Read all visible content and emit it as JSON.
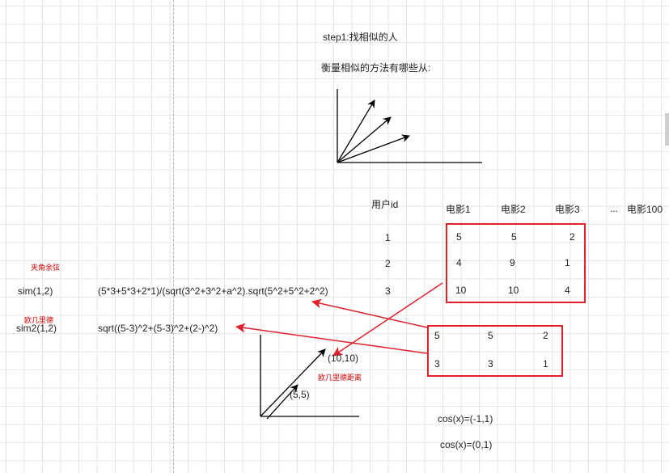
{
  "header": {
    "step": "step1:找相似的人",
    "question": "衡量相似的方法有哪些从:"
  },
  "table": {
    "user_header": "用户id",
    "movie_headers": [
      "电影1",
      "电影2",
      "电影3",
      "...",
      "电影100"
    ],
    "user_ids": [
      "1",
      "2",
      "3"
    ],
    "ratings": [
      [
        "5",
        "5",
        "2"
      ],
      [
        "4",
        "9",
        "1"
      ],
      [
        "10",
        "10",
        "4"
      ]
    ]
  },
  "diff_box": {
    "rows": [
      [
        "5",
        "5",
        "2"
      ],
      [
        "3",
        "3",
        "1"
      ]
    ]
  },
  "cosine": {
    "note": "夹角余弦",
    "label": "sim(1,2)",
    "formula": "(5*3+5*3+2*1)/(sqrt(3^2+3^2+a^2).sqrt(5^2+5^2+2^2)"
  },
  "euclid": {
    "note": "欧几里德",
    "label": "sim2(1,2)",
    "formula": "sqrt((5-3)^2+(5-3)^2+(2-)^2)",
    "distance_note": "欧几里德距离",
    "point_a": "(5,5)",
    "point_b": "(10,10)"
  },
  "cos_examples": [
    "cos(x)=(-1,1)",
    "cos(x)=(0,1)"
  ],
  "colors": {
    "accent_red": "#e0202b",
    "text_red": "#d40000",
    "grid": "#e6e6e6",
    "ink": "#222222"
  }
}
